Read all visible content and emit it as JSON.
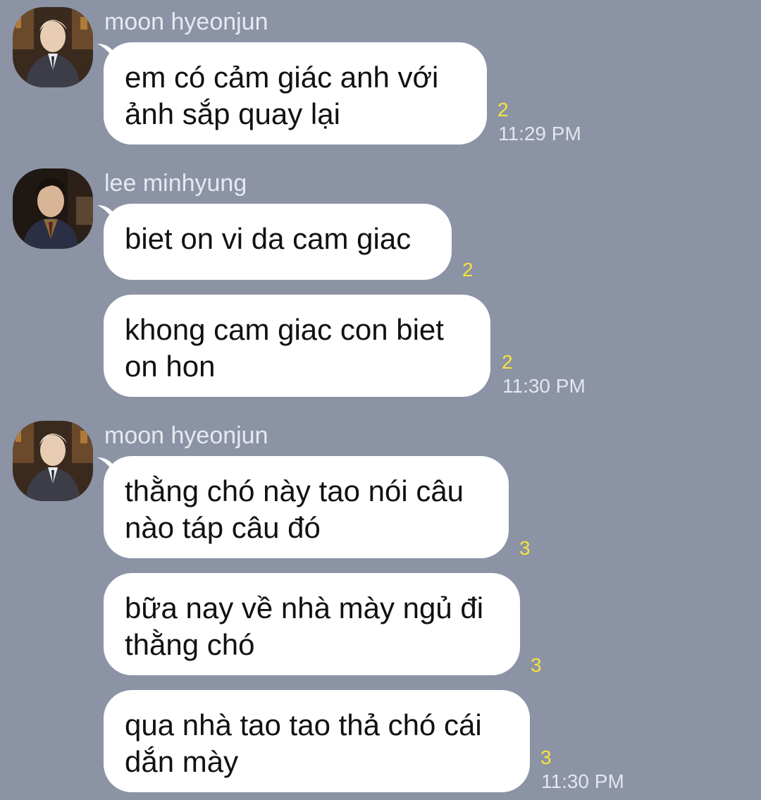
{
  "colors": {
    "background": "#8b93a5",
    "bubble": "#ffffff",
    "unread": "#f5e43c",
    "meta_text": "#e3e6ee"
  },
  "groups": [
    {
      "sender": "moon hyeonjun",
      "messages": [
        {
          "lines": [
            "em có cảm giác anh với",
            "ảnh sắp quay lại"
          ],
          "unread": "2",
          "time": "11:29 PM"
        }
      ]
    },
    {
      "sender": "lee minhyung",
      "messages": [
        {
          "lines": [
            "biet on vi da cam giac"
          ],
          "unread": "2",
          "time": ""
        },
        {
          "lines": [
            "khong cam giac con biet",
            "on hon"
          ],
          "unread": "2",
          "time": "11:30 PM"
        }
      ]
    },
    {
      "sender": "moon hyeonjun",
      "messages": [
        {
          "lines": [
            "thằng chó này tao nói câu",
            "nào táp câu đó"
          ],
          "unread": "3",
          "time": ""
        },
        {
          "lines": [
            "bữa nay về nhà mày ngủ đi",
            "thằng chó"
          ],
          "unread": "3",
          "time": ""
        },
        {
          "lines": [
            "qua nhà tao tao thả chó cái",
            "dắn mày"
          ],
          "unread": "3",
          "time": "11:30 PM"
        }
      ]
    }
  ]
}
